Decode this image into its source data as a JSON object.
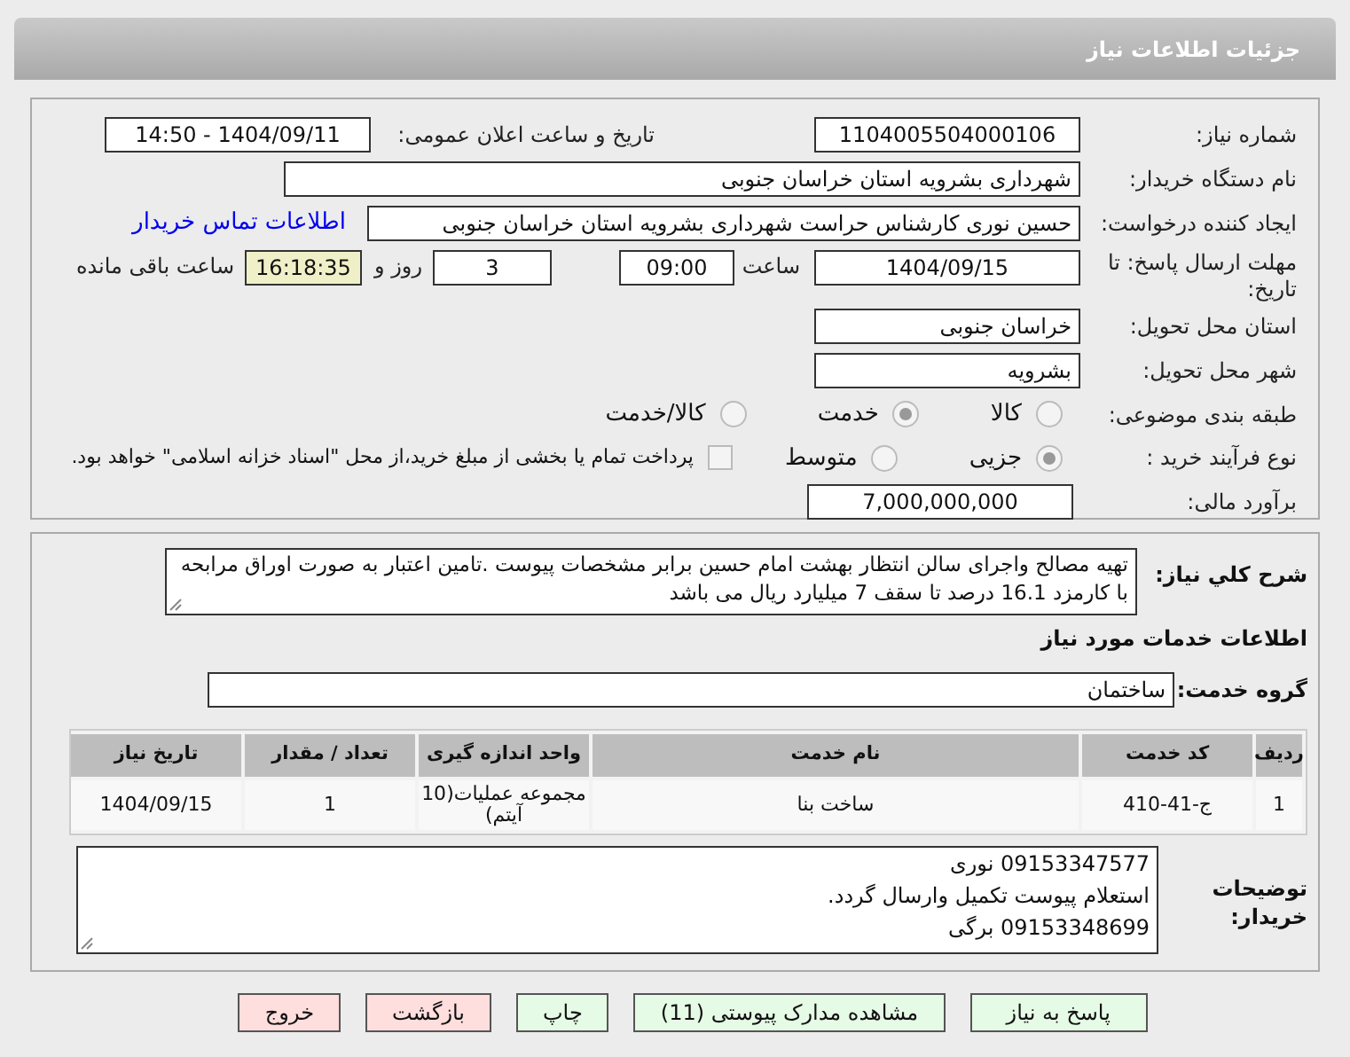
{
  "title": "جزئیات اطلاعات نیاز",
  "need_number": {
    "label": "شماره نیاز:",
    "value": "1104005504000106"
  },
  "announce": {
    "label": "تاریخ و ساعت اعلان عمومی:",
    "value": "1404/09/11 - 14:50"
  },
  "buyer_org": {
    "label": "نام دستگاه خریدار:",
    "value": "شهرداری بشرویه استان خراسان جنوبی"
  },
  "requester": {
    "label": "ایجاد کننده درخواست:",
    "value": "حسین نوری کارشناس حراست شهرداری بشرویه استان خراسان جنوبی",
    "link": "اطلاعات تماس خریدار"
  },
  "deadline": {
    "label": "مهلت ارسال پاسخ: تا تاریخ:",
    "date": "1404/09/15",
    "time_label": "ساعت",
    "time": "09:00",
    "days": "3",
    "days_label": "روز و",
    "remaining": "16:18:35",
    "remaining_label": "ساعت باقی مانده"
  },
  "province": {
    "label": "استان محل تحویل:",
    "value": "خراسان جنوبی"
  },
  "city": {
    "label": "شهر محل تحویل:",
    "value": "بشرویه"
  },
  "classification": {
    "label": "طبقه بندی موضوعی:",
    "options": [
      {
        "label": "کالا",
        "selected": false
      },
      {
        "label": "خدمت",
        "selected": true
      },
      {
        "label": "کالا/خدمت",
        "selected": false
      }
    ]
  },
  "purchase_type": {
    "label": "نوع فرآیند خرید :",
    "options": [
      {
        "label": "جزیی",
        "selected": true
      },
      {
        "label": "متوسط",
        "selected": false
      }
    ],
    "treasury": {
      "label": "پرداخت تمام یا بخشی از مبلغ خرید،از محل \"اسناد خزانه اسلامی\" خواهد بود.",
      "checked": false
    }
  },
  "budget": {
    "label": "برآورد مالی:",
    "value": "7,000,000,000"
  },
  "description": {
    "label": "شرح کلي نياز:",
    "value": "تهیه مصالح واجرای سالن انتظار بهشت امام حسین برابر مشخصات پیوست .تامین اعتبار به صورت اوراق مرابحه با کارمزد 16.1 درصد تا سقف 7 میلیارد ریال می باشد"
  },
  "services_heading": "اطلاعات خدمات مورد نیاز",
  "service_group": {
    "label": "گروه خدمت:",
    "value": "ساختمان"
  },
  "table": {
    "columns": [
      "ردیف",
      "کد خدمت",
      "نام خدمت",
      "واحد اندازه گیری",
      "تعداد / مقدار",
      "تاریخ نیاز"
    ],
    "rows": [
      [
        "1",
        "ج-41-410",
        "ساخت بنا",
        "مجموعه عملیات(10 آیتم)",
        "1",
        "1404/09/15"
      ]
    ]
  },
  "buyer_notes": {
    "label": "توضیحات خریدار:",
    "lines": [
      "09153347577 نوری",
      "استعلام پیوست تکمیل وارسال گردد.",
      "09153348699 برگی"
    ]
  },
  "buttons": [
    {
      "label": "پاسخ به نیاز",
      "kind": "primary"
    },
    {
      "label": "مشاهده مدارک پیوستی (11)",
      "kind": "primary"
    },
    {
      "label": "چاپ",
      "kind": "primary"
    },
    {
      "label": "بازگشت",
      "kind": "danger"
    },
    {
      "label": "خروج",
      "kind": "danger"
    }
  ]
}
